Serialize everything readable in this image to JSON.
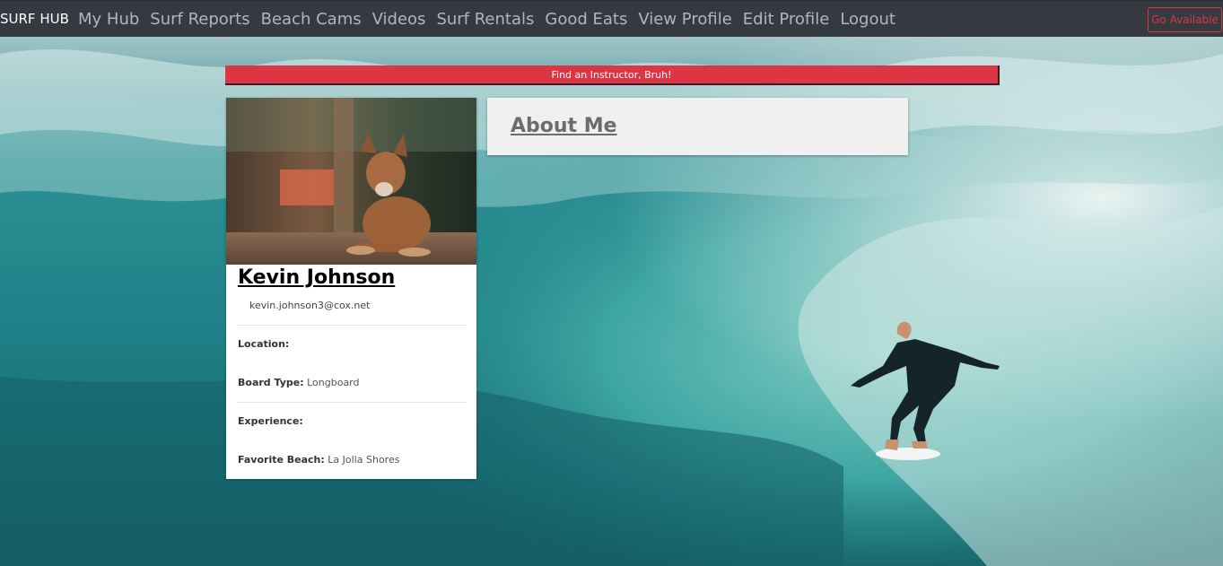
{
  "navbar": {
    "brand": "SURF HUB",
    "links": [
      "My Hub",
      "Surf Reports",
      "Beach Cams",
      "Videos",
      "Surf Rentals",
      "Good Eats",
      "View Profile",
      "Edit Profile",
      "Logout"
    ],
    "go_available": "Go Available"
  },
  "banner": {
    "text": "Find an Instructor, Bruh!"
  },
  "profile": {
    "photo": "dog-photo",
    "name": "Kevin Johnson",
    "email": "kevin.johnson3@cox.net",
    "location_label": "Location:",
    "location_value": "",
    "board_label": "Board Type:",
    "board_value": "Longboard",
    "experience_label": "Experience:",
    "experience_value": "",
    "beach_label": "Favorite Beach:",
    "beach_value": "La Jolla Shores"
  },
  "about": {
    "title": "About Me"
  },
  "colors": {
    "navbar": "#343a40",
    "accent_red": "#dc3545",
    "ocean": "#1d7f86"
  }
}
